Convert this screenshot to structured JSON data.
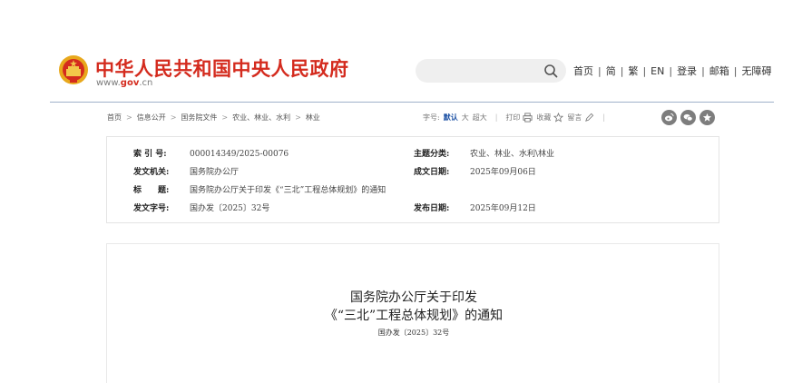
{
  "header": {
    "site_title": "中华人民共和国中央人民政府",
    "domain_prefix": "www.",
    "domain_gov": "gov",
    "domain_suffix": ".cn",
    "search_placeholder": "",
    "nav": [
      "首页",
      "简",
      "繁",
      "EN",
      "登录",
      "邮箱",
      "无障碍"
    ]
  },
  "breadcrumb": [
    "首页",
    "信息公开",
    "国务院文件",
    "农业、林业、水利",
    "林业"
  ],
  "tools": {
    "font_size_label": "字号:",
    "font_default": "默认",
    "font_large": "大",
    "font_xlarge": "超大",
    "print": "打印",
    "favorite": "收藏",
    "comment": "留言"
  },
  "share_icons": [
    "weibo-icon",
    "wechat-icon",
    "favorite-star-icon"
  ],
  "meta": {
    "index_label": "索 引 号:",
    "index_value": "000014349/2025-00076",
    "category_label": "主题分类:",
    "category_value": "农业、林业、水利\\林业",
    "issuer_label": "发文机关:",
    "issuer_value": "国务院办公厅",
    "written_label": "成文日期:",
    "written_value": "2025年09月06日",
    "title_label": "标　　题:",
    "title_value": "国务院办公厅关于印发《“三北”工程总体规划》的通知",
    "docno_label": "发文字号:",
    "docno_value": "国办发〔2025〕32号",
    "published_label": "发布日期:",
    "published_value": "2025年09月12日"
  },
  "article": {
    "title_line1": "国务院办公厅关于印发",
    "title_line2": "《“三北”工程总体规划》的通知",
    "doc_number": "国办发〔2025〕32号"
  },
  "colors": {
    "brand_red": "#d42b1e",
    "link_blue": "#1a4fa3",
    "rule": "#9fb1c9"
  }
}
